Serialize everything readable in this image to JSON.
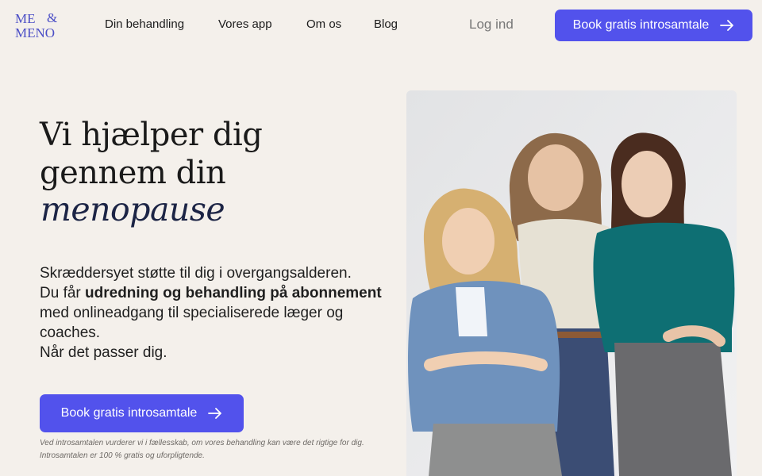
{
  "brand": {
    "logo_line1": "ME",
    "logo_amp": "&",
    "logo_line2": "MENO"
  },
  "nav": {
    "links": [
      "Din behandling",
      "Vores app",
      "Om os",
      "Blog"
    ],
    "login": "Log ind",
    "cta": "Book gratis introsamtale"
  },
  "hero": {
    "headline": "Vi hjælper dig gennem din",
    "headline_emphasis": "menopause",
    "desc_line1": "Skræddersyet støtte til dig i overgangsalderen.",
    "desc_pre": "Du får ",
    "desc_bold": "udredning og behandling på abonnement",
    "desc_post": " med onlineadgang til specialiserede læger og coaches.",
    "desc_line3": "Når det passer dig.",
    "cta": "Book gratis introsamtale",
    "note": "Ved introsamtalen vurderer vi i fællesskab, om vores behandling kan være det rigtige for dig. Introsamtalen er 100 % gratis og uforpligtende."
  },
  "colors": {
    "accent": "#5252ec",
    "background": "#f4f0eb",
    "logo": "#4c4fc6"
  },
  "icons": {
    "cta_arrow": "arrow-right-icon"
  }
}
